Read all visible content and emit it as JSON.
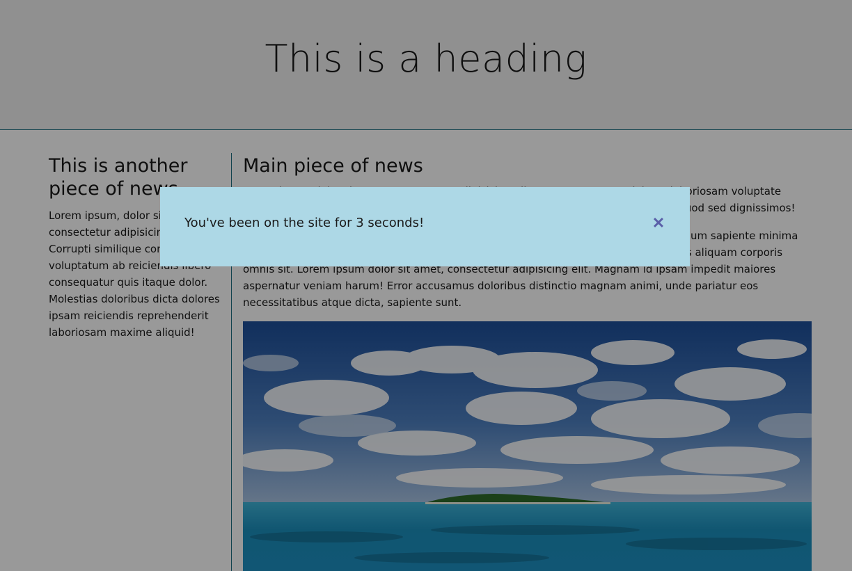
{
  "header": {
    "title": "This is a heading"
  },
  "sidebar": {
    "title": "This is another piece of news",
    "body": "Lorem ipsum, dolor sit amet consectetur adipisicing elit. Corrupti similique commodi voluptatum ab reiciendis libero consequatur quis itaque dolor. Molestias doloribus dicta dolores ipsam reiciendis reprehenderit laboriosam maxime aliquid!"
  },
  "main": {
    "title": "Main piece of news",
    "paragraphs": [
      "Lorem ipsum dolor sit amet consectetur adipisicing elit. Quae aspernatur dolores laboriosam voluptate quasi repellendus eius, tempore ipsum magnam ipsa consectetur, quas, non eum. Quod sed dignissimos!",
      "Lorem ipsum dolor sit amet consectetur adipisicing elit. Quibusdam exercitationem illum sapiente minima ipsam iusto ipsa beatae, praesentium nisi laboriosam voluptatibus, quaerat reiciendis aliquam corporis omnis sit. Lorem ipsum dolor sit amet, consectetur adipisicing elit. Magnam id ipsam impedit maiores aspernatur veniam harum! Error accusamus doloribus distinctio magnam animi, unde pariatur eos necessitatibus atque dicta, sapiente sunt."
    ]
  },
  "modal": {
    "message": "You've been on the site for 3 seconds!",
    "close_glyph": "✕",
    "close_icon": "close-icon"
  },
  "colors": {
    "header_border": "#1b6f80",
    "modal_bg": "#add8e6",
    "close_icon": "#5a5fa8",
    "overlay": "rgba(0,0,0,0.4)"
  }
}
